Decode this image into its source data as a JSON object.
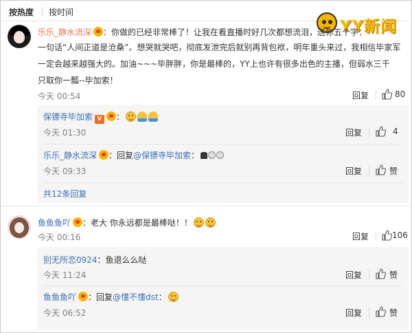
{
  "sort": {
    "hot": "按热度",
    "time": "按时间"
  },
  "logo": {
    "text": "YY新闻"
  },
  "comments": [
    {
      "user": "乐乐_静水流深",
      "text_lines": [
        "：你做的已经非常棒了！让我在看直播时好几次都想流泪，送你五个字：",
        "一句话“人间正道是沧桑”。想哭就哭吧，彻底发泄完后就别再背包袱，明年重头来过，我相信毕家军",
        "一定会越来越强大的。加油~~~毕胖胖，你是最棒的，YY上也许有很多出色的主播，但弱水三千",
        "只取你一瓢--毕加索！"
      ],
      "time": "今天 00:54",
      "reply_label": "回复",
      "likes": "80",
      "replies": [
        {
          "user": "保镖寺毕加索",
          "text": "：",
          "time": "今天 01:30",
          "reply_label": "回复",
          "likes": "4"
        },
        {
          "user": "乐乐_静水流深",
          "text": "：回复",
          "mention": "@保镖寺毕加索",
          "tail": "：",
          "time": "今天 09:33",
          "reply_label": "回复",
          "likes": "赞"
        }
      ],
      "more": "共12条回复"
    },
    {
      "user": "鱼鱼鱼吖",
      "text": "：老大 你永远都是最棒哒！！",
      "time": "今天 00:16",
      "reply_label": "回复",
      "likes": "106",
      "replies": [
        {
          "user": "别无所恋0924",
          "text": "：鱼退么么哒",
          "time": "今天 11:24",
          "reply_label": "回复",
          "likes": "赞"
        },
        {
          "user": "鱼鱼鱼吖",
          "text": "：回复",
          "mention": "@懂不懂dst",
          "tail": "：",
          "time": "今天 06:52",
          "reply_label": "回复",
          "likes": "赞"
        }
      ]
    }
  ],
  "colors": {
    "username": "#eb7350",
    "link": "#3a70b5",
    "muted": "#808080",
    "subbox": "#f5f5f5"
  }
}
